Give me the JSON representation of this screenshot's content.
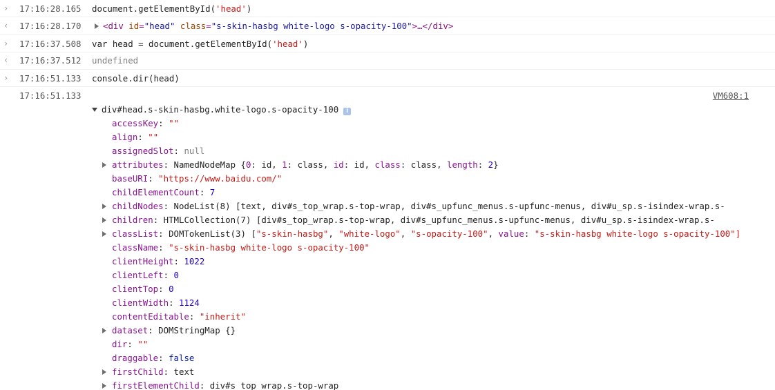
{
  "entries": [
    {
      "gutter": "›",
      "ts": "17:16:28.165",
      "cmd": "document.getElementById(",
      "arg": "'head'",
      "close": ")"
    },
    {
      "gutter": "‹",
      "ts": "17:16:28.170",
      "html": {
        "open": "<div",
        "id_name": " id",
        "eq1": "=",
        "id_val": "\"head\"",
        "class_name": " class",
        "eq2": "=",
        "class_val": "\"s-skin-hasbg white-logo s-opacity-100\"",
        "rest": ">…</div>"
      }
    },
    {
      "gutter": "›",
      "ts": "17:16:37.508",
      "cmd": "var head = document.getElementById(",
      "arg": "'head'",
      "close": ")"
    },
    {
      "gutter": "‹",
      "ts": "17:16:37.512",
      "result": "undefined"
    },
    {
      "gutter": "›",
      "ts": "17:16:51.133",
      "cmd": "console.dir(head)"
    }
  ],
  "dir_output": {
    "ts": "17:16:51.133",
    "source": "VM608:1",
    "header": "div#head.s-skin-hasbg.white-logo.s-opacity-100",
    "badge": "i",
    "props": [
      {
        "key": "accessKey",
        "parts": [
          {
            "c": "str",
            "t": "\"\""
          }
        ]
      },
      {
        "key": "align",
        "parts": [
          {
            "c": "str",
            "t": "\"\""
          }
        ]
      },
      {
        "key": "assignedSlot",
        "parts": [
          {
            "c": "gray",
            "t": "null"
          }
        ]
      },
      {
        "key": "attributes",
        "expand": true,
        "parts": [
          {
            "c": "plain",
            "t": "NamedNodeMap {"
          },
          {
            "c": "key",
            "t": "0"
          },
          {
            "c": "plain",
            "t": ": "
          },
          {
            "c": "plain",
            "t": "id"
          },
          {
            "c": "plain",
            "t": ", "
          },
          {
            "c": "key",
            "t": "1"
          },
          {
            "c": "plain",
            "t": ": "
          },
          {
            "c": "plain",
            "t": "class"
          },
          {
            "c": "plain",
            "t": ", "
          },
          {
            "c": "key",
            "t": "id"
          },
          {
            "c": "plain",
            "t": ": "
          },
          {
            "c": "plain",
            "t": "id"
          },
          {
            "c": "plain",
            "t": ", "
          },
          {
            "c": "key",
            "t": "class"
          },
          {
            "c": "plain",
            "t": ": "
          },
          {
            "c": "plain",
            "t": "class"
          },
          {
            "c": "plain",
            "t": ", "
          },
          {
            "c": "key",
            "t": "length"
          },
          {
            "c": "plain",
            "t": ": "
          },
          {
            "c": "num",
            "t": "2"
          },
          {
            "c": "plain",
            "t": "}"
          }
        ]
      },
      {
        "key": "baseURI",
        "parts": [
          {
            "c": "str",
            "t": "\"https://www.baidu.com/\""
          }
        ]
      },
      {
        "key": "childElementCount",
        "parts": [
          {
            "c": "num",
            "t": "7"
          }
        ]
      },
      {
        "key": "childNodes",
        "expand": true,
        "parts": [
          {
            "c": "plain",
            "t": "NodeList(8) [text, div#s_top_wrap.s-top-wrap, div#s_upfunc_menus.s-upfunc-menus, div#u_sp.s-isindex-wrap.s-"
          }
        ]
      },
      {
        "key": "children",
        "expand": true,
        "parts": [
          {
            "c": "plain",
            "t": "HTMLCollection(7) [div#s_top_wrap.s-top-wrap, div#s_upfunc_menus.s-upfunc-menus, div#u_sp.s-isindex-wrap.s-"
          }
        ]
      },
      {
        "key": "classList",
        "expand": true,
        "parts": [
          {
            "c": "plain",
            "t": "DOMTokenList(3) ["
          },
          {
            "c": "str",
            "t": "\"s-skin-hasbg\""
          },
          {
            "c": "plain",
            "t": ", "
          },
          {
            "c": "str",
            "t": "\"white-logo\""
          },
          {
            "c": "plain",
            "t": ", "
          },
          {
            "c": "str",
            "t": "\"s-opacity-100\""
          },
          {
            "c": "plain",
            "t": ", "
          },
          {
            "c": "key",
            "t": "value"
          },
          {
            "c": "plain",
            "t": ": "
          },
          {
            "c": "str",
            "t": "\"s-skin-hasbg white-logo s-opacity-100\"]"
          }
        ]
      },
      {
        "key": "className",
        "parts": [
          {
            "c": "str",
            "t": "\"s-skin-hasbg white-logo s-opacity-100\""
          }
        ]
      },
      {
        "key": "clientHeight",
        "parts": [
          {
            "c": "num",
            "t": "1022"
          }
        ]
      },
      {
        "key": "clientLeft",
        "parts": [
          {
            "c": "num",
            "t": "0"
          }
        ]
      },
      {
        "key": "clientTop",
        "parts": [
          {
            "c": "num",
            "t": "0"
          }
        ]
      },
      {
        "key": "clientWidth",
        "parts": [
          {
            "c": "num",
            "t": "1124"
          }
        ]
      },
      {
        "key": "contentEditable",
        "parts": [
          {
            "c": "str",
            "t": "\"inherit\""
          }
        ]
      },
      {
        "key": "dataset",
        "expand": true,
        "parts": [
          {
            "c": "plain",
            "t": "DOMStringMap {}"
          }
        ]
      },
      {
        "key": "dir",
        "parts": [
          {
            "c": "str",
            "t": "\"\""
          }
        ]
      },
      {
        "key": "draggable",
        "parts": [
          {
            "c": "bool",
            "t": "false"
          }
        ]
      },
      {
        "key": "firstChild",
        "expand": true,
        "parts": [
          {
            "c": "plain",
            "t": "text"
          }
        ]
      },
      {
        "key": "firstElementChild",
        "expand": true,
        "parts": [
          {
            "c": "plain",
            "t": "div#s_top_wrap.s-top-wrap"
          }
        ]
      }
    ]
  }
}
